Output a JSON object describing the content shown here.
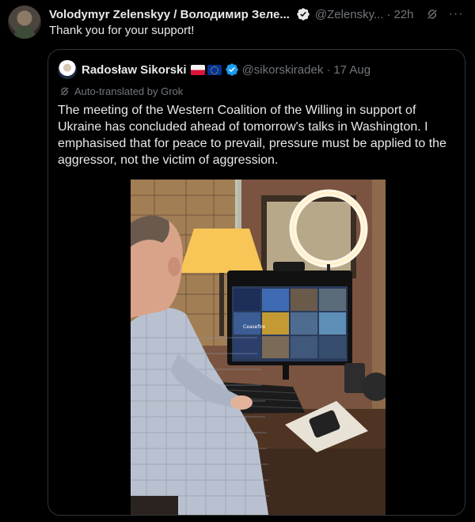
{
  "post": {
    "author_name": "Volodymyr Zelenskyy / Володимир Зеле...",
    "handle": "@Zelensky...",
    "time": "22h",
    "more_label": "···",
    "text": "Thank you for your support!"
  },
  "quoted": {
    "author_name": "Radosław Sikorski",
    "handle": "@sikorskiradek",
    "time": "17 Aug",
    "translated_label": "Auto-translated by Grok",
    "text": "The meeting of the Western Coalition of the Willing in support of Ukraine has concluded ahead of tomorrow's talks in Washington. I emphasised that for peace to prevail, pressure must be applied to the aggressor, not the victim of aggression.",
    "photo_screen_text": "Ceasefire"
  },
  "colors": {
    "background": "#000000",
    "text_primary": "#e7e9ea",
    "text_secondary": "#71767b",
    "verified_blue": "#1d9bf0",
    "border": "#2f3336"
  },
  "icons": {
    "verified": "verified-badge-icon",
    "grok": "grok-icon",
    "more": "more-icon",
    "translate": "grok-translate-icon"
  }
}
